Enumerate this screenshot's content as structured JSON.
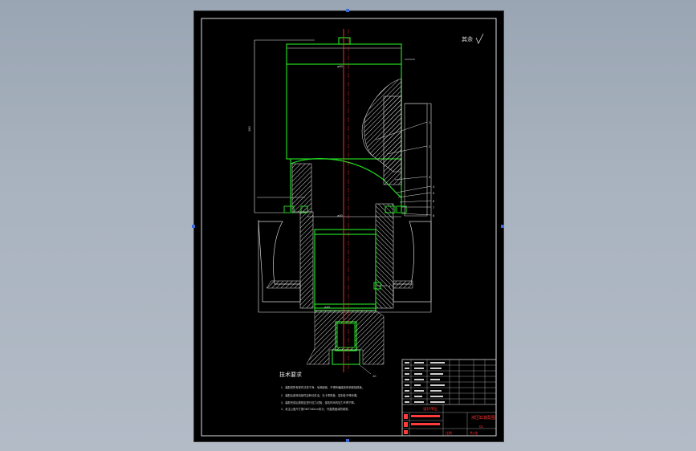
{
  "surface_roughness_note": "其余",
  "technical_requirements": {
    "title": "技术要求",
    "items": [
      "1、装配前所有零件清洗干净，毛刺倒钝，不得有磕碰划伤和锈蚀现象。",
      "2、装配后各转动部件应转动灵活，无卡滞现象，密封处不得渗漏。",
      "3、装配完成后按规定进行压力试验，保压时间内压力不得下降。",
      "4、未注公差尺寸按GB/T1804-m执行，外露表面涂防锈漆。"
    ]
  },
  "part_labels": [
    "1",
    "2",
    "3",
    "4",
    "5",
    "6",
    "7",
    "8",
    "9",
    "10",
    "11",
    "12",
    "13",
    "14"
  ],
  "title_block": {
    "title_red": "液压缸装配图",
    "drawing_no": "01",
    "company": "设计单位",
    "scale": "比例",
    "sheet": "共1张"
  },
  "colors": {
    "outline": "#22d622",
    "centerline": "#ff2a2a",
    "dimension": "#e8e8e8",
    "hatch": "#d8d8d8",
    "title_text": "#ff3030",
    "frame_tick": "#3b6bd6"
  }
}
